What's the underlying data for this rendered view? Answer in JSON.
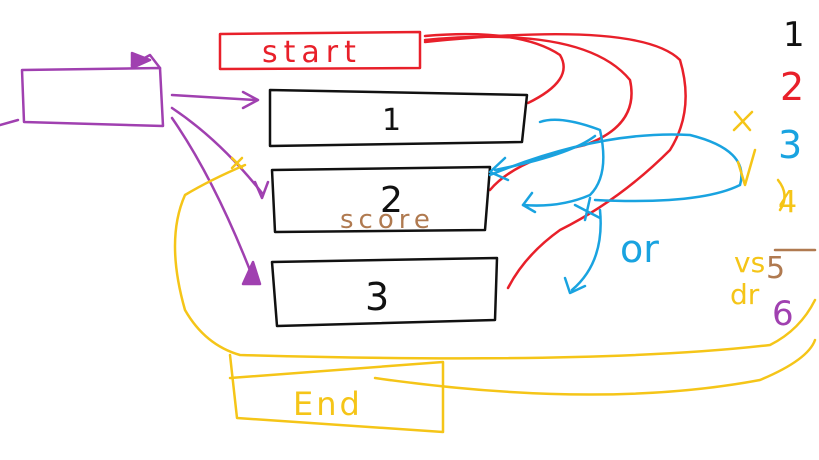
{
  "colors": {
    "red": "#e8202a",
    "black": "#111111",
    "blue": "#19a3e0",
    "yellow": "#f5c518",
    "purple": "#a040b0",
    "brown": "#b07a50"
  },
  "boxes": {
    "start": "start",
    "box1": "1",
    "box2": "2",
    "box2_note": "score",
    "box3": "3",
    "end": "End"
  },
  "notes": {
    "blue_or": "or",
    "yellow_vs": "vs",
    "yellow_dr": "dr"
  },
  "legend": {
    "items": [
      {
        "label": "1",
        "color_key": "black"
      },
      {
        "label": "2",
        "color_key": "red"
      },
      {
        "label": "3",
        "color_key": "blue"
      },
      {
        "label": "4",
        "color_key": "yellow"
      },
      {
        "label": "5",
        "color_key": "brown"
      },
      {
        "label": "6",
        "color_key": "purple"
      }
    ]
  }
}
